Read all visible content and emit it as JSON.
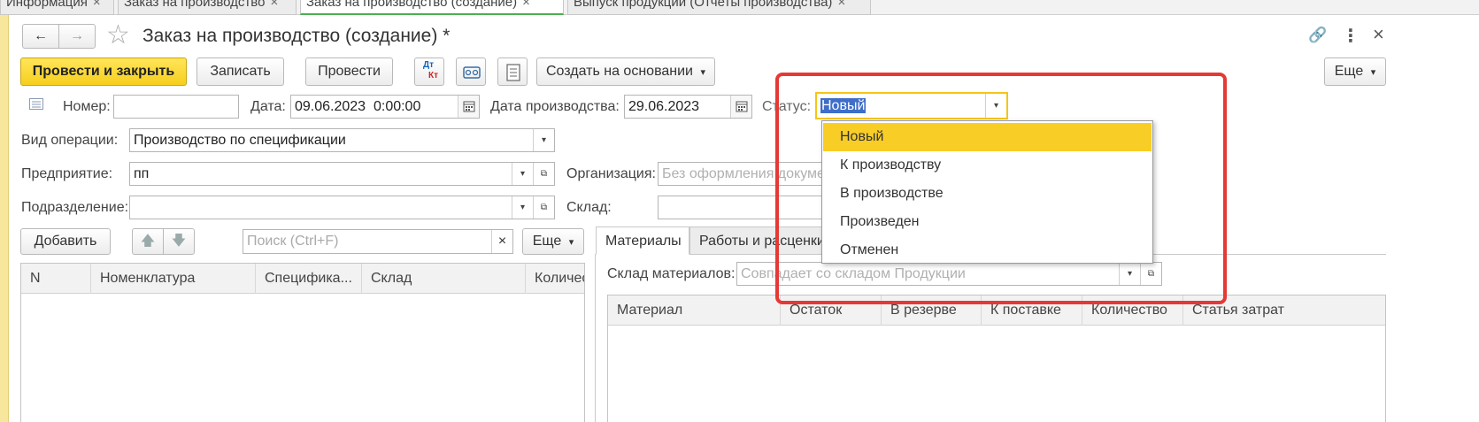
{
  "top_tabs": [
    {
      "label": "Информация",
      "close": "×"
    },
    {
      "label": "Заказ на производство",
      "close": "×"
    },
    {
      "label": "Заказ на производство (создание)",
      "close": "×"
    },
    {
      "label": "Выпуск продукции (Отчеты производства)",
      "close": "×"
    }
  ],
  "header": {
    "back": "←",
    "forward": "→",
    "star": "☆",
    "title": "Заказ на производство (создание) *",
    "link_icon": "🔗",
    "more_icon": "⋮",
    "close_icon": "×"
  },
  "toolbar": {
    "post_close": "Провести и закрыть",
    "save": "Записать",
    "post": "Провести",
    "dtkt_top": "Дт",
    "dtkt_bottom": "Кт",
    "create_based": "Создать на основании",
    "create_based_arrow": "▾",
    "more": "Еще",
    "more_arrow": "▾"
  },
  "form": {
    "number_label": "Номер:",
    "number_value": "",
    "date_label": "Дата:",
    "date_value": "09.06.2023  0:00:00",
    "prod_date_label": "Дата производства:",
    "prod_date_value": "29.06.2023",
    "status_label": "Статус:",
    "status_value": "Новый",
    "operation_label": "Вид операции:",
    "operation_value": "Производство по спецификации",
    "enterprise_label": "Предприятие:",
    "enterprise_value": "пп",
    "organization_label": "Организация:",
    "organization_placeholder": "Без оформления документов",
    "division_label": "Подразделение:",
    "division_value": "",
    "warehouse_label": "Склад:",
    "warehouse_value": "",
    "dd_arrow": "▾",
    "open_icon": "⧉"
  },
  "status_options": [
    "Новый",
    "К производству",
    "В производстве",
    "Произведен",
    "Отменен"
  ],
  "products": {
    "add": "Добавить",
    "up": "🡅",
    "down": "🡇",
    "search_placeholder": "Поиск (Ctrl+F)",
    "clear": "×",
    "more": "Еще",
    "more_arrow": "▾",
    "columns": [
      "N",
      "Номенклатура",
      "Специфика...",
      "Склад",
      "Количество"
    ]
  },
  "materials": {
    "tabs": [
      "Материалы",
      "Работы и расценки"
    ],
    "warehouse_label": "Склад материалов:",
    "warehouse_placeholder": "Совпадает со складом Продукции",
    "columns": [
      "Материал",
      "Остаток",
      "В резерве",
      "К поставке",
      "Количество",
      "Статья затрат"
    ]
  }
}
